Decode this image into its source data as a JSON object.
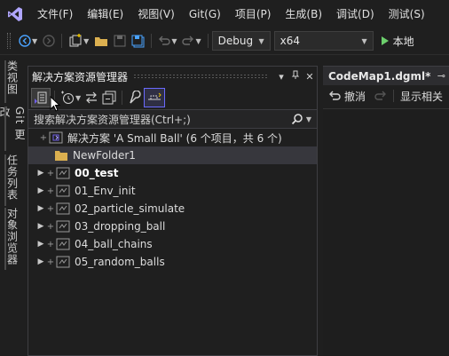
{
  "menu": {
    "items": [
      "文件(F)",
      "编辑(E)",
      "视图(V)",
      "Git(G)",
      "项目(P)",
      "生成(B)",
      "调试(D)",
      "测试(S)"
    ]
  },
  "toolbar": {
    "config": "Debug",
    "platform": "x64",
    "run_label": "本地"
  },
  "vtabs": [
    "类视图",
    "Git 更改",
    "任务列表",
    "对象浏览器"
  ],
  "solution_explorer": {
    "title": "解决方案资源管理器",
    "search_placeholder": "搜索解决方案资源管理器(Ctrl+;)",
    "solution_label": "解决方案 'A Small Ball' (6 个项目，共 6 个)",
    "folder": "NewFolder1",
    "projects": [
      {
        "name": "00_test",
        "bold": true
      },
      {
        "name": "01_Env_init",
        "bold": false
      },
      {
        "name": "02_particle_simulate",
        "bold": false
      },
      {
        "name": "03_dropping_ball",
        "bold": false
      },
      {
        "name": "04_ball_chains",
        "bold": false
      },
      {
        "name": "05_random_balls",
        "bold": false
      }
    ]
  },
  "document": {
    "tab_title": "CodeMap1.dgml*",
    "undo_label": "撤消",
    "show_related_label": "显示相关"
  },
  "colors": {
    "accent": "#7160e8",
    "background": "#1f1f1f",
    "selection": "#37373d"
  }
}
